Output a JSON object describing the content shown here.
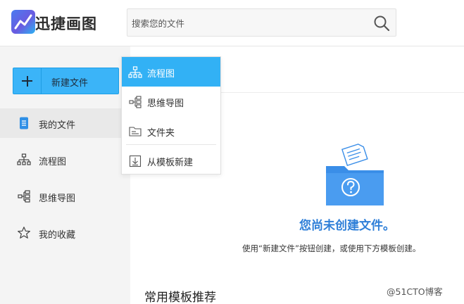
{
  "app": {
    "brand": "迅捷画图"
  },
  "search": {
    "placeholder": "搜索您的文件"
  },
  "sidebar": {
    "new_button_label": "新建文件",
    "items": [
      {
        "label": "我的文件",
        "icon": "document-icon",
        "active": true
      },
      {
        "label": "流程图",
        "icon": "flowchart-icon",
        "active": false
      },
      {
        "label": "思维导图",
        "icon": "mindmap-icon",
        "active": false
      },
      {
        "label": "我的收藏",
        "icon": "star-icon",
        "active": false
      }
    ]
  },
  "dropdown": {
    "items": [
      {
        "label": "流程图",
        "icon": "flowchart-icon",
        "active": true
      },
      {
        "label": "思维导图",
        "icon": "mindmap-icon",
        "active": false
      },
      {
        "label": "文件夹",
        "icon": "folder-icon",
        "active": false
      },
      {
        "label": "从模板新建",
        "icon": "template-icon",
        "active": false
      }
    ]
  },
  "empty_state": {
    "title": "您尚未创建文件。",
    "description": "使用“新建文件”按钮创建，或使用下方模板创建。"
  },
  "templates": {
    "section_title": "常用模板推荐"
  },
  "watermark": "@51CTO博客",
  "colors": {
    "accent": "#3bb4f8",
    "title_blue": "#2f7fd8",
    "folder_blue": "#3a8ee8"
  }
}
